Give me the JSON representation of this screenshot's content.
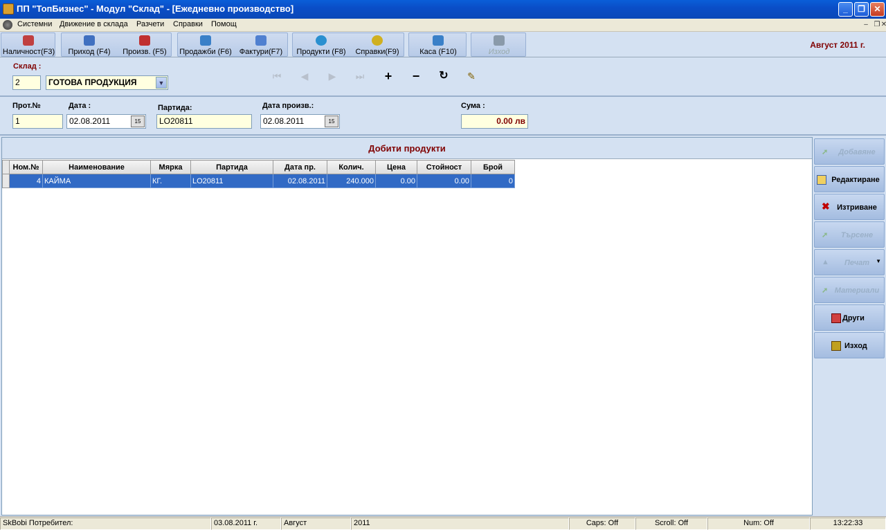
{
  "window": {
    "title": "ПП \"ТопБизнес\" - Модул \"Склад\" - [Ежедневно производство]"
  },
  "menu": [
    "Системни",
    "Движение в склада",
    "Разчети",
    "Справки",
    "Помощ"
  ],
  "toolbar": {
    "items": [
      {
        "label": "Наличност(F3)",
        "icon": "chart-icon",
        "color": "#c04040"
      },
      {
        "label": "Приход (F4)",
        "icon": "document-icon",
        "color": "#4070c0"
      },
      {
        "label": "Произв. (F5)",
        "icon": "factory-icon",
        "color": "#c03030"
      },
      {
        "label": "Продажби (F6)",
        "icon": "sales-icon",
        "color": "#3a80c8"
      },
      {
        "label": "Фактури(F7)",
        "icon": "invoice-icon",
        "color": "#5080d0"
      },
      {
        "label": "Продукти (F8)",
        "icon": "products-icon",
        "color": "#2a90d0"
      },
      {
        "label": "Справки(F9)",
        "icon": "report-icon",
        "color": "#d0b020"
      },
      {
        "label": "Каса (F10)",
        "icon": "cash-icon",
        "color": "#3a80c8"
      },
      {
        "label": "Изход",
        "icon": "exit-icon",
        "color": "#8a9aaa"
      }
    ],
    "period": "Август 2011 г."
  },
  "warehouse": {
    "label": "Склад :",
    "code": "2",
    "name": "ГОТОВА ПРОДУКЦИЯ"
  },
  "nav": {
    "add": "+",
    "remove": "−",
    "refresh": "↻",
    "edit": "✎"
  },
  "doc": {
    "prot_label": "Прот.№",
    "prot_value": "1",
    "date_label": "Дата :",
    "date_value": "02.08.2011",
    "batch_label": "Партида:",
    "batch_value": "LO20811",
    "proddate_label": "Дата произв.:",
    "proddate_value": "02.08.2011",
    "sum_label": "Сума :",
    "sum_value": "0.00 лв",
    "cal_text": "15"
  },
  "grid": {
    "title": "Добити продукти",
    "columns": [
      "Ном.№",
      "Наименование",
      "Мярка",
      "Партида",
      "Дата пр.",
      "Колич.",
      "Цена",
      "Стойност",
      "Брой"
    ],
    "rows": [
      [
        "4",
        "КАЙМА",
        "КГ.",
        "LO20811",
        "02.08.2011",
        "240.000",
        "0.00",
        "0.00",
        "0"
      ]
    ]
  },
  "side": [
    {
      "label": "Добавяне",
      "disabled": true
    },
    {
      "label": "Редактиране",
      "disabled": false
    },
    {
      "label": "Изтриване",
      "disabled": false
    },
    {
      "label": "Търсене",
      "disabled": true
    },
    {
      "label": "Печат",
      "disabled": true
    },
    {
      "label": "Материали",
      "disabled": true
    },
    {
      "label": "Други",
      "disabled": false
    },
    {
      "label": "Изход",
      "disabled": false
    }
  ],
  "status": {
    "user": "SkBobi Потребител:",
    "date": "03.08.2011 г.",
    "month": "Август",
    "year": "2011",
    "caps": "Caps: Off",
    "scroll": "Scroll: Off",
    "num": "Num: Off",
    "time": "13:22:33"
  }
}
